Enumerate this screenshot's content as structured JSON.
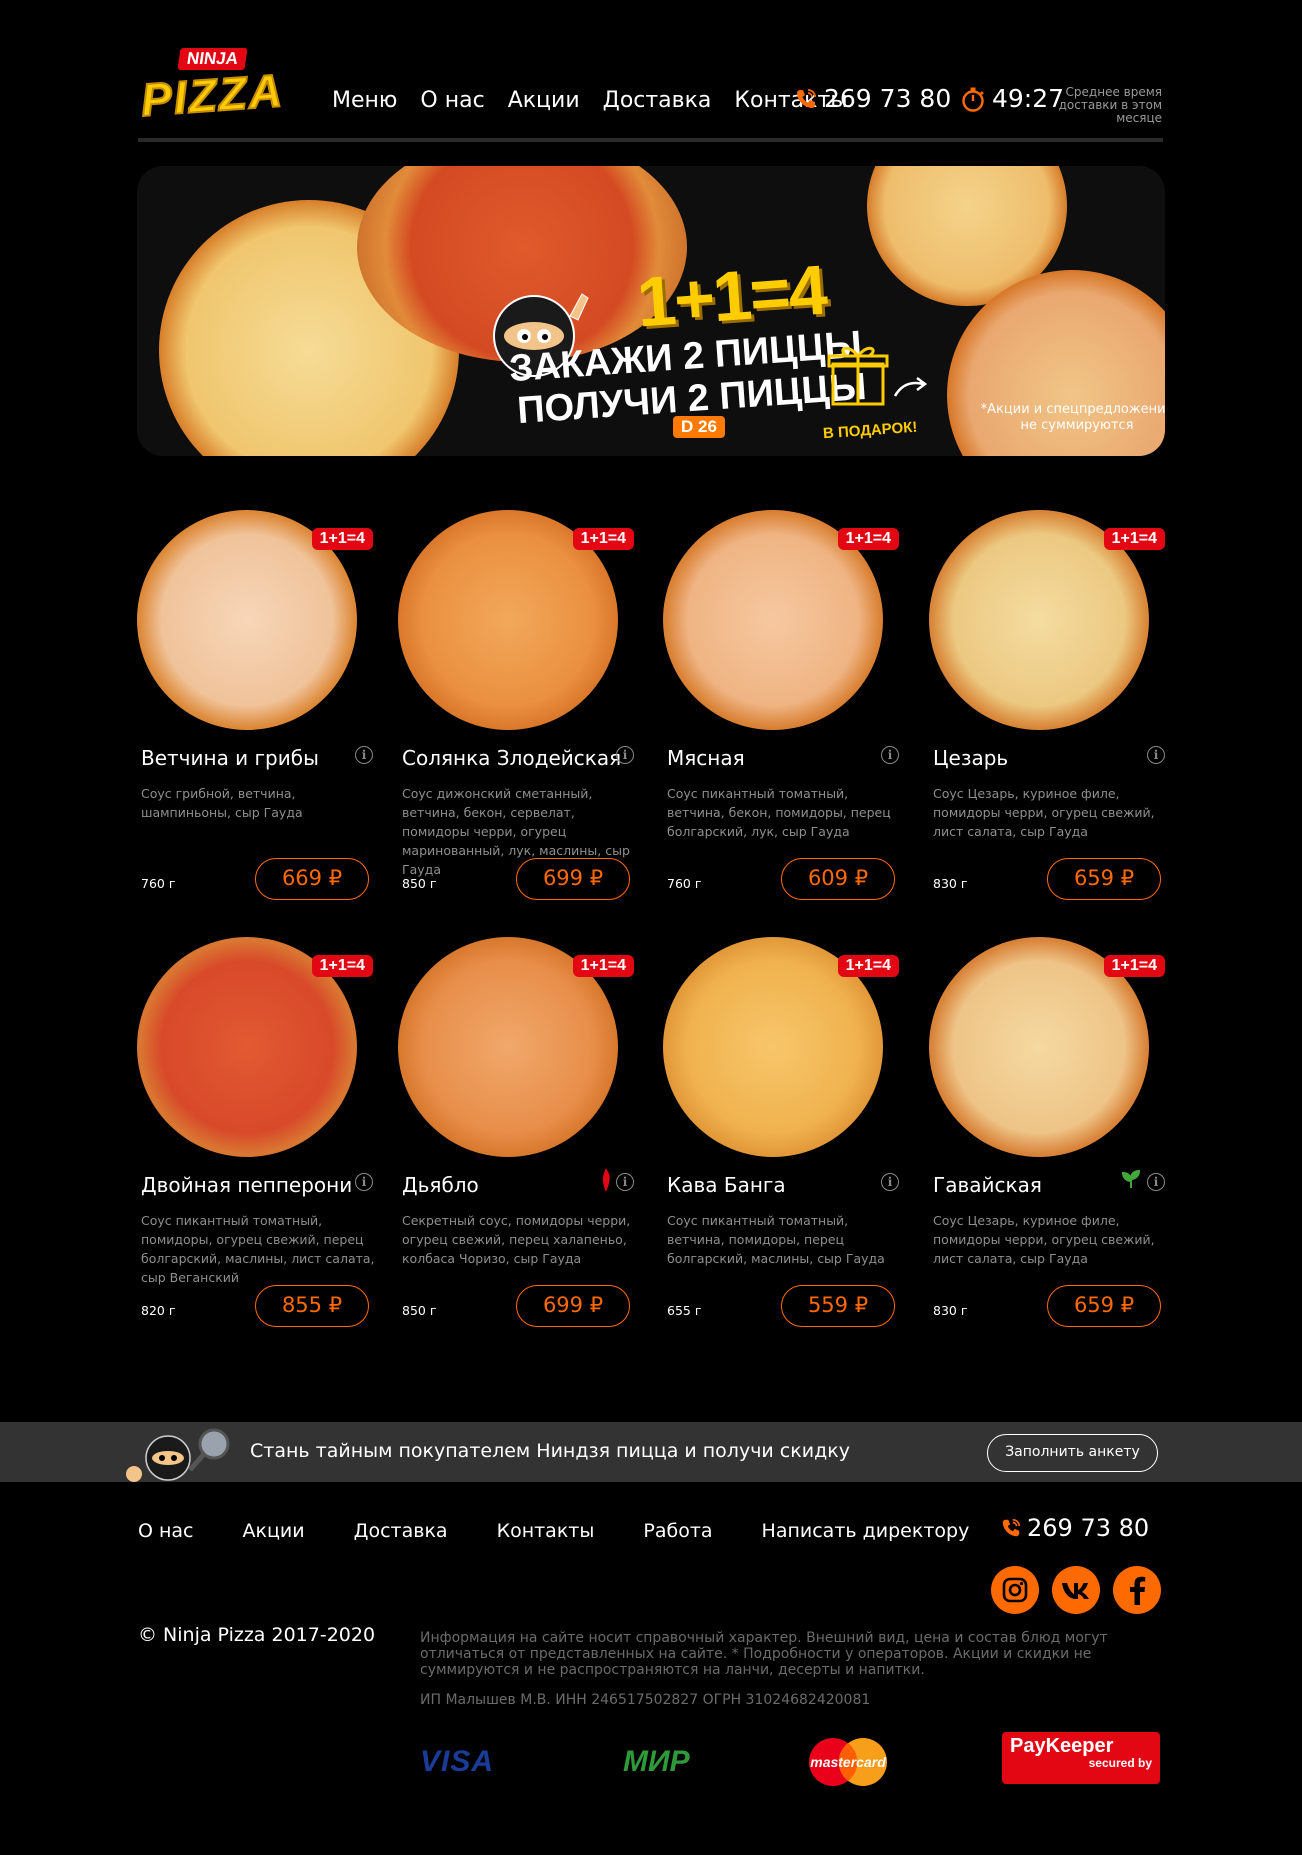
{
  "brand": {
    "small": "NINJA",
    "big": "PIZZA"
  },
  "nav": [
    "Меню",
    "О нас",
    "Акции",
    "Доставка",
    "Контакты"
  ],
  "header": {
    "phone": "269 73 80",
    "delivery_time": "49:27",
    "delivery_caption": "Среднее время доставки в этом месяце"
  },
  "banner": {
    "promo": "1+1=4",
    "line1": "ЗАКАЖИ 2 ПИЦЦЫ",
    "line2": "ПОЛУЧИ 2 ПИЦЦЫ",
    "code": "D 26",
    "gift": "В ПОДАРОК!",
    "note": "*Акции и спецпредложения не суммируются"
  },
  "products": [
    {
      "name": "Ветчина и грибы",
      "desc": "Соус грибной, ветчина, шампиньоны, сыр Гауда",
      "weight": "760 г",
      "price": "669 ₽",
      "badge": "1+1=4"
    },
    {
      "name": "Солянка Злодейская",
      "desc": "Соус дижонский сметанный, ветчина, бекон, сервелат, помидоры черри, огурец маринованный, лук, маслины, сыр Гауда",
      "weight": "850 г",
      "price": "699 ₽",
      "badge": "1+1=4"
    },
    {
      "name": "Мясная",
      "desc": "Соус пикантный томатный, ветчина, бекон, помидоры, перец болгарский, лук, сыр Гауда",
      "weight": "760 г",
      "price": "609 ₽",
      "badge": "1+1=4"
    },
    {
      "name": "Цезарь",
      "desc": "Соус Цезарь, куриное филе, помидоры черри, огурец свежий, лист салата, сыр Гауда",
      "weight": "830 г",
      "price": "659 ₽",
      "badge": "1+1=4"
    },
    {
      "name": "Двойная пепперони",
      "desc": "Соус пикантный томатный, помидоры, огурец свежий, перец болгарский, маслины, лист салата, сыр Веганский",
      "weight": "820 г",
      "price": "855 ₽",
      "badge": "1+1=4"
    },
    {
      "name": "Дьябло",
      "desc": "Секретный соус, помидоры черри, огурец свежий, перец халапеньо, колбаса Чоризо, сыр Гауда",
      "weight": "850 г",
      "price": "699 ₽",
      "badge": "1+1=4"
    },
    {
      "name": "Кава Банга",
      "desc": "Соус пикантный томатный, ветчина, помидоры, перец болгарский, маслины, сыр Гауда",
      "weight": "655 г",
      "price": "559 ₽",
      "badge": "1+1=4"
    },
    {
      "name": "Гавайская",
      "desc": "Соус Цезарь, куриное филе, помидоры черри, огурец свежий, лист салата, сыр Гауда",
      "weight": "830 г",
      "price": "659 ₽",
      "badge": "1+1=4"
    }
  ],
  "shopper": {
    "text": "Стань тайным покупателем Ниндзя пицца и получи скидку",
    "button": "Заполнить анкету"
  },
  "footer": {
    "nav": [
      "О нас",
      "Акции",
      "Доставка",
      "Контакты",
      "Работа",
      "Написать директору"
    ],
    "phone": "269 73 80",
    "copyright": "© Ninja Pizza 2017-2020",
    "legal": "Информация на сайте носит справочный характер. Внешний вид, цена и состав блюд могут отличаться от представленных на сайте. * Подробности у операторов. Акции и скидки не суммируются и не распространяются на ланчи, десерты и напитки.",
    "inn": "ИП Малышев М.В. ИНН 246517502827 ОГРН 31024682420081",
    "payments": {
      "visa": "VISA",
      "mir": "МИР",
      "mastercard": "mastercard",
      "paykeeper": "PayKeeper",
      "paykeeper_sub": "secured by"
    }
  },
  "colors": {
    "accent": "#ff6a00",
    "badge": "#e30613",
    "bg": "#000000",
    "logo": "#ffcc00"
  }
}
